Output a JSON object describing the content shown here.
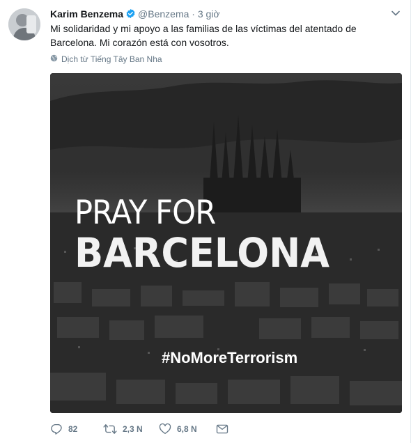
{
  "tweet": {
    "author_name": "Karim Benzema",
    "handle": "@Benzema",
    "separator": "·",
    "time": "3 giờ",
    "text": "Mi solidaridad y mi apoyo a las familias de las víctimas del atentado de Barcelona. Mi corazón está con vosotros.",
    "translate_label": "Dịch từ Tiếng Tây Ban Nha"
  },
  "media": {
    "line1": "PRAY FOR",
    "line2": "BARCELONA",
    "hashtag": "#NoMoreTerrorism"
  },
  "actions": {
    "replies": "82",
    "retweets": "2,3 N",
    "likes": "6,8 N"
  },
  "colors": {
    "verified": "#1da1f2",
    "secondary_text": "#657786",
    "icon": "#657786"
  },
  "icons": [
    "verified-icon",
    "chevron-down-icon",
    "globe-icon",
    "reply-icon",
    "retweet-icon",
    "heart-icon",
    "direct-message-icon"
  ]
}
